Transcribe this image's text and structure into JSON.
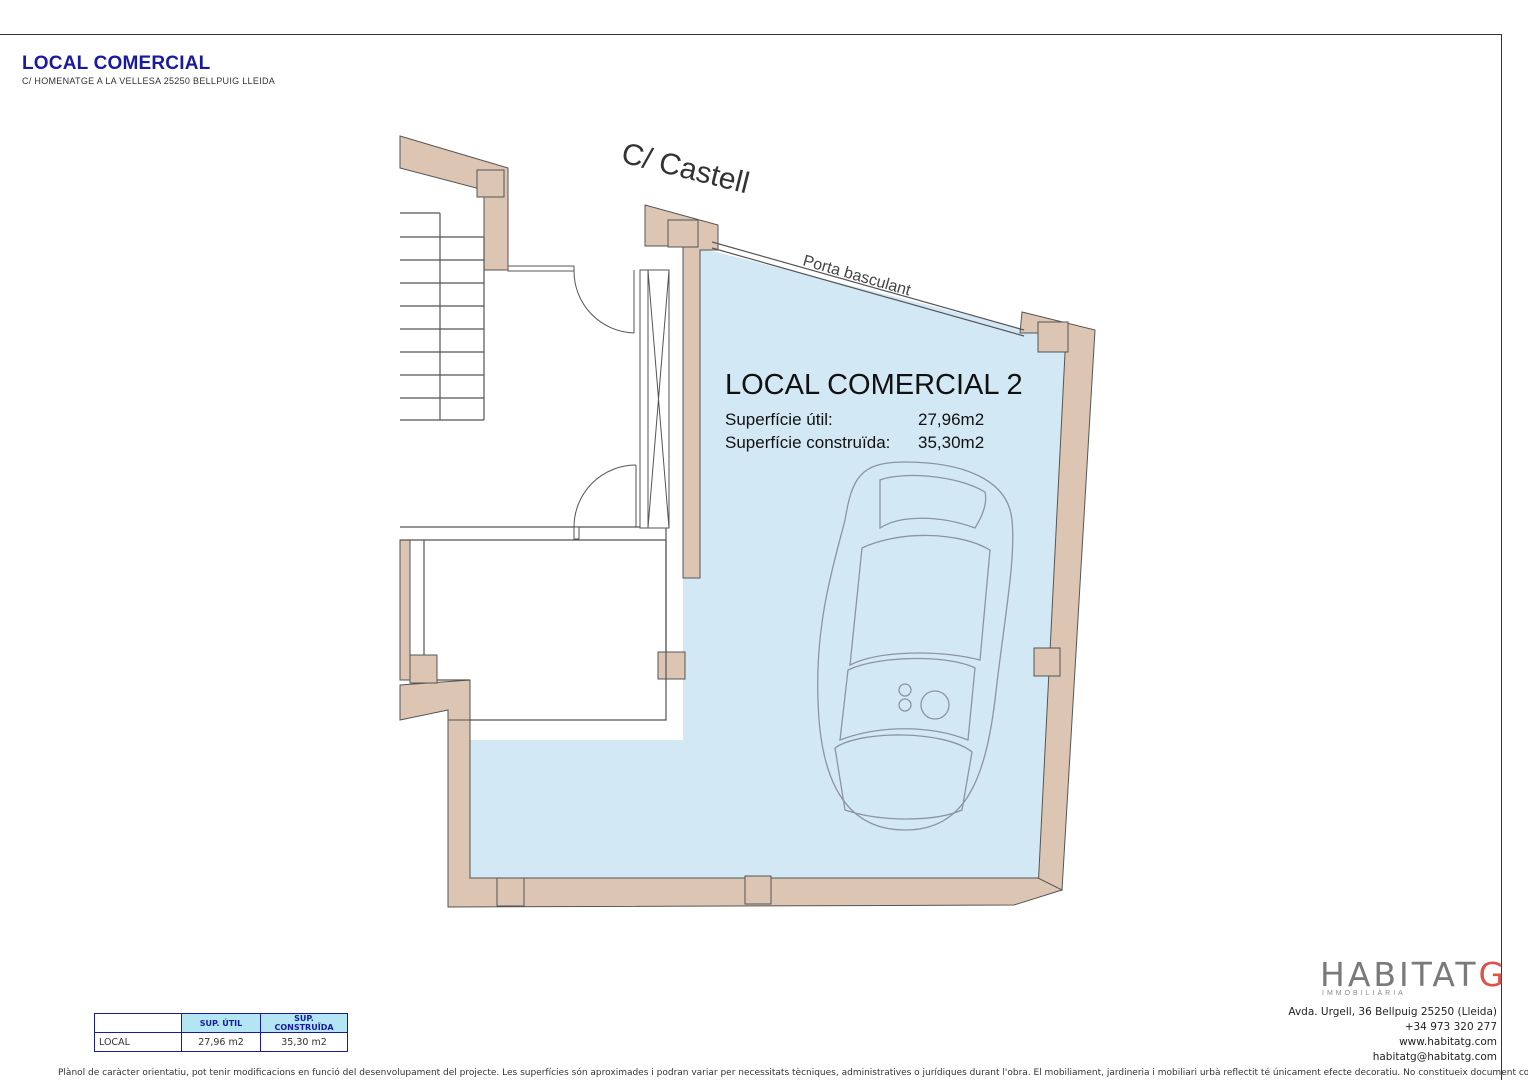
{
  "header": {
    "title": "LOCAL COMERCIAL",
    "subtitle": "C/ HOMENATGE A LA VELLESA  25250 BELLPUIG LLEIDA"
  },
  "plan": {
    "street_label": "C/ Castell",
    "door_label": "Porta basculant",
    "room_title": "LOCAL COMERCIAL 2",
    "util_label": "Superfície útil:",
    "util_value": "27,96m2",
    "built_label": "Superfície construïda:",
    "built_value": "35,30m2",
    "colors": {
      "wall": "#dcc5b2",
      "floor": "#d3e8f5",
      "line": "#555555"
    }
  },
  "summary_table": {
    "headers": [
      "",
      "SUP. ÚTIL",
      "SUP. CONSTRUÏDA"
    ],
    "rows": [
      [
        "LOCAL",
        "27,96 m2",
        "35,30 m2"
      ]
    ]
  },
  "logo": {
    "main": "HABITAT",
    "accent": "G",
    "sub": "IMMOBILIÀRIA"
  },
  "contact": {
    "address": "Avda. Urgell, 36 Bellpuig 25250 (Lleida)",
    "phone": "+34 973 320 277",
    "web": "www.habitatg.com",
    "email": "habitatg@habitatg.com"
  },
  "disclaimer": "Plànol de caràcter orientatiu, pot tenir modificacions en funció del desenvolupament del projecte. Les superfícies són aproximades i podran variar per necessitats tècniques, administratives o jurídiques durant l'obra. El mobiliament, jardineria i mobiliari urbà reflectit té únicament efecte decoratiu. No constitueix document contractual."
}
